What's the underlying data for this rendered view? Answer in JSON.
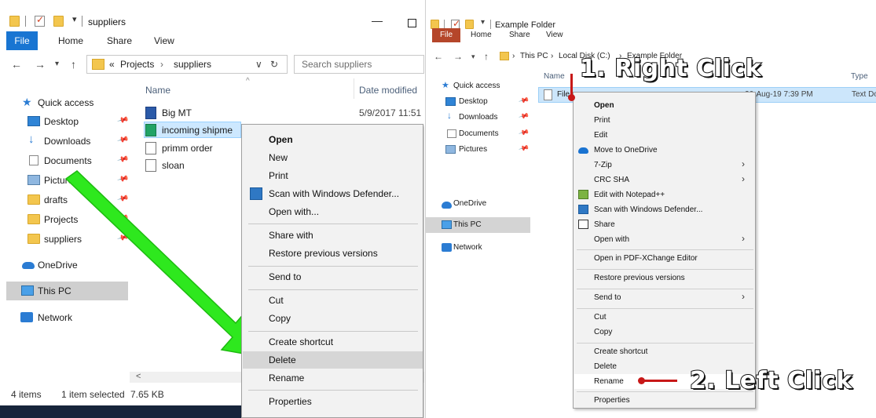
{
  "left": {
    "title": "suppliers",
    "ribbon_tabs": [
      "File",
      "Home",
      "Share",
      "View"
    ],
    "address": {
      "prefix": "«",
      "crumbs": [
        "Projects",
        "suppliers"
      ]
    },
    "search_placeholder": "Search suppliers",
    "nav_items": [
      {
        "label": "Quick access",
        "icon": "star-icon"
      },
      {
        "label": "Desktop",
        "icon": "desktop-icon"
      },
      {
        "label": "Downloads",
        "icon": "download-icon"
      },
      {
        "label": "Documents",
        "icon": "documents-icon"
      },
      {
        "label": "Pictures",
        "icon": "pictures-icon"
      },
      {
        "label": "drafts",
        "icon": "folder-icon"
      },
      {
        "label": "Projects",
        "icon": "folder-icon"
      },
      {
        "label": "suppliers",
        "icon": "folder-icon"
      },
      {
        "label": "OneDrive",
        "icon": "onedrive-icon"
      },
      {
        "label": "This PC",
        "icon": "this-pc-icon"
      },
      {
        "label": "Network",
        "icon": "network-icon"
      }
    ],
    "columns": [
      "Name",
      "Date modified"
    ],
    "files": [
      {
        "name": "Big MT",
        "date": "5/9/2017 11:51",
        "icon": "word-icon"
      },
      {
        "name": "incoming shipme",
        "date": "",
        "icon": "excel-icon"
      },
      {
        "name": "primm order",
        "date": "",
        "icon": "pdf-icon"
      },
      {
        "name": "sloan",
        "date": "",
        "icon": "pdf-icon"
      }
    ],
    "status": {
      "count": "4 items",
      "selected": "1 item selected",
      "size": "7.65 KB"
    },
    "context_menu": [
      "Open",
      "New",
      "Print",
      "Scan with Windows Defender...",
      "Open with...",
      "Share with",
      "Restore previous versions",
      "Send to",
      "Cut",
      "Copy",
      "Create shortcut",
      "Delete",
      "Rename",
      "Properties"
    ]
  },
  "right": {
    "title": "Example Folder",
    "ribbon_tabs": [
      "File",
      "Home",
      "Share",
      "View"
    ],
    "address": {
      "crumbs": [
        "This PC",
        "Local Disk (C:)",
        "Example Folder"
      ]
    },
    "nav_items": [
      {
        "label": "Quick access"
      },
      {
        "label": "Desktop"
      },
      {
        "label": "Downloads"
      },
      {
        "label": "Documents"
      },
      {
        "label": "Pictures"
      },
      {
        "label": "OneDrive"
      },
      {
        "label": "This PC"
      },
      {
        "label": "Network"
      }
    ],
    "columns": [
      "Name",
      "Type"
    ],
    "file": {
      "name": "File",
      "date": "26-Aug-19 7:39 PM",
      "type": "Text Do"
    },
    "context_menu": [
      "Open",
      "Print",
      "Edit",
      "Move to OneDrive",
      "7-Zip",
      "CRC SHA",
      "Edit with Notepad++",
      "Scan with Windows Defender...",
      "Share",
      "Open with",
      "Open in PDF-XChange Editor",
      "Restore previous versions",
      "Send to",
      "Cut",
      "Copy",
      "Create shortcut",
      "Delete",
      "Rename",
      "Properties"
    ]
  },
  "callouts": {
    "step1": "1. Right Click",
    "step2": "2. Left Click"
  },
  "colors": {
    "accent": "#1975d2",
    "arrow": "#2ee81e",
    "annotation": "#c81818"
  }
}
